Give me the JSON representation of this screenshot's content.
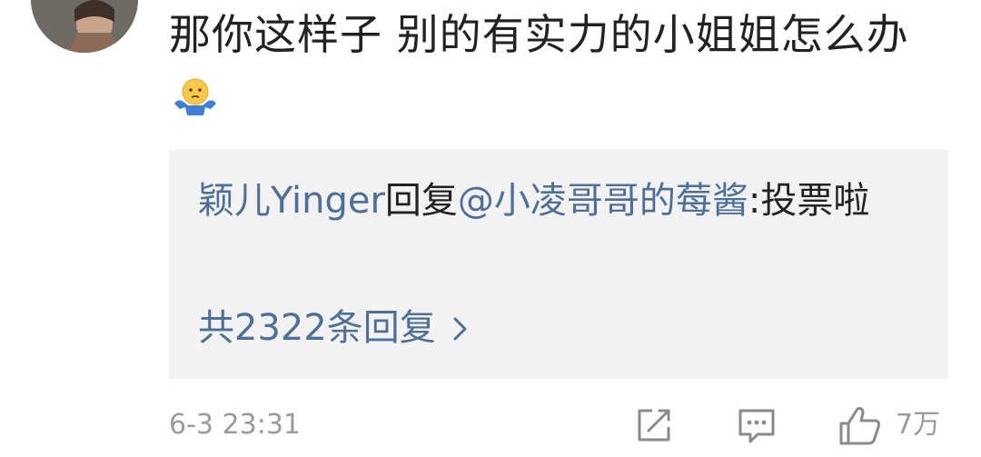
{
  "comment": {
    "text": "那你这样子 别的有实力的小姐姐怎么办",
    "emoji": "person-shrugging-emoji"
  },
  "reply": {
    "author": "颖儿Yinger",
    "verb": "回复",
    "mention": "@小凌哥哥的莓酱",
    "colon": ":",
    "text": "投票啦"
  },
  "replies_link": {
    "label": "共2322条回复",
    "icon": "chevron-right-icon"
  },
  "footer": {
    "timestamp": "6-3 23:31",
    "like_count": "7万",
    "icons": [
      "repost-icon",
      "comment-icon",
      "like-icon"
    ]
  },
  "colors": {
    "link": "#4e6f98",
    "text": "#222222",
    "meta": "#9a9a9a",
    "reply_bg": "#f2f2f2"
  }
}
